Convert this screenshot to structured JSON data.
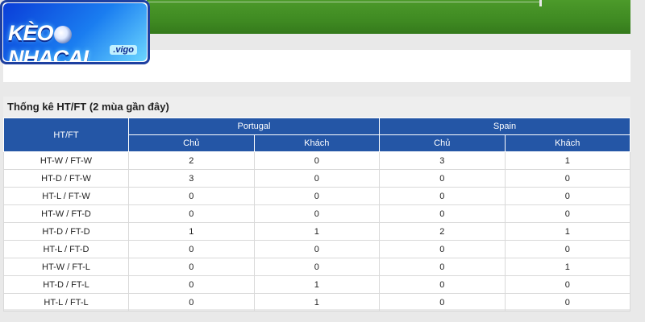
{
  "logo": {
    "text_a": "KÈO",
    "text_b": "NHACAI",
    "sub": ".vigo"
  },
  "stats": {
    "title": "Thống kê HT/FT (2 mùa gần đây)",
    "row_header": "HT/FT",
    "teams": [
      "Portugal",
      "Spain"
    ],
    "sub_headers": [
      "Chủ",
      "Khách",
      "Chủ",
      "Khách"
    ],
    "rows": [
      {
        "label": "HT-W / FT-W",
        "values": [
          "2",
          "0",
          "3",
          "1"
        ]
      },
      {
        "label": "HT-D / FT-W",
        "values": [
          "3",
          "0",
          "0",
          "0"
        ]
      },
      {
        "label": "HT-L / FT-W",
        "values": [
          "0",
          "0",
          "0",
          "0"
        ]
      },
      {
        "label": "HT-W / FT-D",
        "values": [
          "0",
          "0",
          "0",
          "0"
        ]
      },
      {
        "label": "HT-D / FT-D",
        "values": [
          "1",
          "1",
          "2",
          "1"
        ]
      },
      {
        "label": "HT-L / FT-D",
        "values": [
          "0",
          "0",
          "0",
          "0"
        ]
      },
      {
        "label": "HT-W / FT-L",
        "values": [
          "0",
          "0",
          "0",
          "1"
        ]
      },
      {
        "label": "HT-D / FT-L",
        "values": [
          "0",
          "1",
          "0",
          "0"
        ]
      },
      {
        "label": "HT-L / FT-L",
        "values": [
          "0",
          "1",
          "0",
          "0"
        ]
      }
    ]
  },
  "colors": {
    "header_blue": "#2456a6",
    "banner_green": "#3f8a22"
  }
}
